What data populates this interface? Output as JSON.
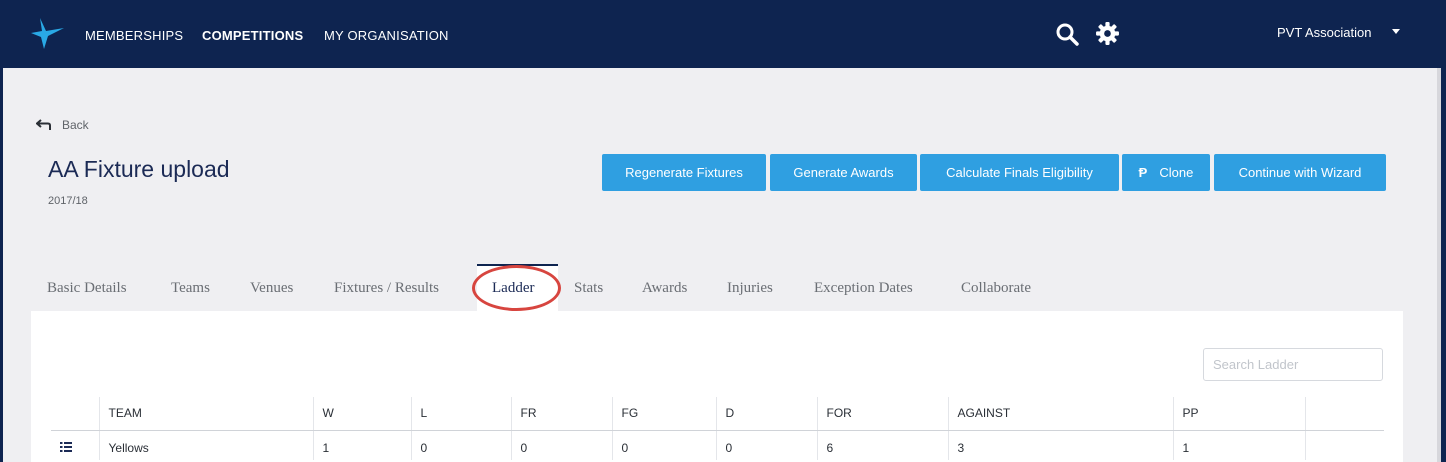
{
  "nav": {
    "items": [
      {
        "label": "MEMBERSHIPS"
      },
      {
        "label": "COMPETITIONS"
      },
      {
        "label": "MY ORGANISATION"
      }
    ],
    "org": "PVT Association"
  },
  "colors": {
    "navy": "#0e2450",
    "button": "#2f9fe1",
    "highlight": "#d7453f",
    "background": "#efeff2"
  },
  "page": {
    "back_label": "Back",
    "title": "AA Fixture upload",
    "season": "2017/18"
  },
  "actions": [
    {
      "label": "Regenerate Fixtures"
    },
    {
      "label": "Generate Awards"
    },
    {
      "label": "Calculate Finals Eligibility"
    },
    {
      "label": "Clone"
    },
    {
      "label": "Continue with Wizard"
    }
  ],
  "tabs": [
    {
      "label": "Basic Details"
    },
    {
      "label": "Teams"
    },
    {
      "label": "Venues"
    },
    {
      "label": "Fixtures / Results"
    },
    {
      "label": "Ladder"
    },
    {
      "label": "Stats"
    },
    {
      "label": "Awards"
    },
    {
      "label": "Injuries"
    },
    {
      "label": "Exception Dates"
    },
    {
      "label": "Collaborate"
    }
  ],
  "active_tab": "Ladder",
  "ladder": {
    "search_placeholder": "Search Ladder",
    "columns": [
      "TEAM",
      "W",
      "L",
      "FR",
      "FG",
      "D",
      "FOR",
      "AGAINST",
      "PP"
    ],
    "rows": [
      {
        "team": "Yellows",
        "w": "1",
        "l": "0",
        "fr": "0",
        "fg": "0",
        "d": "0",
        "for": "6",
        "against": "3",
        "pp": "1"
      }
    ]
  },
  "icons": [
    "logo-star-icon",
    "search-icon",
    "gear-icon",
    "chevron-down-icon",
    "back-arrow-icon",
    "clone-icon",
    "drag-handle-icon"
  ]
}
